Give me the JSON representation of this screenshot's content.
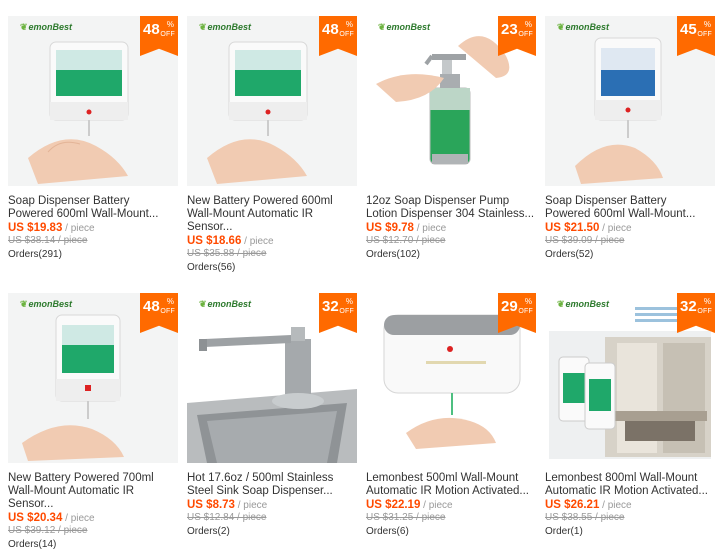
{
  "products": [
    {
      "brand": "emonBest",
      "discount": "48",
      "pct": "%",
      "off": "OFF",
      "title": "Soap Dispenser Battery Powered 600ml Wall-Mount...",
      "price": "US $19.83",
      "unit": " / piece",
      "original": "US $38.14 / piece",
      "orders": "Orders(291)"
    },
    {
      "brand": "emonBest",
      "discount": "48",
      "pct": "%",
      "off": "OFF",
      "title": "New Battery Powered 600ml Wall-Mount Automatic IR Sensor...",
      "price": "US $18.66",
      "unit": " / piece",
      "original": "US $35.88 / piece",
      "orders": "Orders(56)"
    },
    {
      "brand": "emonBest",
      "discount": "23",
      "pct": "%",
      "off": "OFF",
      "title": "12oz Soap Dispenser Pump Lotion Dispenser 304 Stainless...",
      "price": "US $9.78",
      "unit": " / piece",
      "original": "US $12.70 / piece",
      "orders": "Orders(102)"
    },
    {
      "brand": "emonBest",
      "discount": "45",
      "pct": "%",
      "off": "OFF",
      "title": "Soap Dispenser Battery Powered 600ml Wall-Mount...",
      "price": "US $21.50",
      "unit": " / piece",
      "original": "US $39.09 / piece",
      "orders": "Orders(52)"
    },
    {
      "brand": "emonBest",
      "discount": "48",
      "pct": "%",
      "off": "OFF",
      "title": "New Battery Powered 700ml Wall-Mount Automatic IR Sensor...",
      "price": "US $20.34",
      "unit": " / piece",
      "original": "US $39.12 / piece",
      "orders": "Orders(14)"
    },
    {
      "brand": "emonBest",
      "discount": "32",
      "pct": "%",
      "off": "OFF",
      "title": "Hot 17.6oz / 500ml Stainless Steel Sink Soap Dispenser...",
      "price": "US $8.73",
      "unit": " / piece",
      "original": "US $12.84 / piece",
      "orders": "Orders(2)"
    },
    {
      "brand": "",
      "discount": "29",
      "pct": "%",
      "off": "OFF",
      "title": "Lemonbest 500ml Wall-Mount Automatic IR Motion Activated...",
      "price": "US $22.19",
      "unit": " / piece",
      "original": "US $31.25 / piece",
      "orders": "Orders(6)"
    },
    {
      "brand": "emonBest",
      "discount": "32",
      "pct": "%",
      "off": "OFF",
      "title": "Lemonbest 800ml Wall-Mount Automatic IR Motion Activated...",
      "price": "US $26.21",
      "unit": " / piece",
      "original": "US $38.55 / piece",
      "orders": "Order(1)"
    }
  ]
}
